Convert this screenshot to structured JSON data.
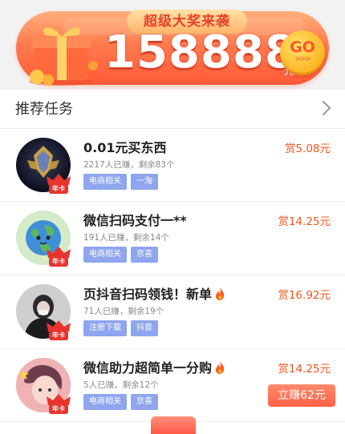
{
  "banner": {
    "title": "超级大奖来袭",
    "amount": "158888",
    "unit": "元",
    "go_label": "GO",
    "go_arrows": ">>>"
  },
  "section": {
    "title": "推荐任务"
  },
  "tasks": [
    {
      "title": "0.01元买东西",
      "stats": "2217人已赚，剩余83个",
      "tags": [
        "电商相关",
        "一淘"
      ],
      "reward": "赏5.08元",
      "badge": "年卡"
    },
    {
      "title": "微信扫码支付一**",
      "stats": "191人已赚，剩余14个",
      "tags": [
        "电商相关",
        "京喜"
      ],
      "reward": "赏14.25元",
      "badge": "年卡"
    },
    {
      "title": "页抖音扫码领钱！新单",
      "stats": "71人已赚，剩余19个",
      "tags": [
        "注册下载",
        "抖音"
      ],
      "reward": "赏16.92元",
      "badge": "年卡"
    },
    {
      "title": "微信助力超简单一分购",
      "stats": "5人已赚，剩余12个",
      "tags": [
        "电商相关",
        "京喜"
      ],
      "reward": "赏14.25元",
      "button": "立赚62元",
      "badge": "年卡"
    }
  ],
  "icons": {
    "chevron": "chevron-right-icon",
    "fire": "fire-icon",
    "crown": "crown-icon",
    "gift": "gift-icon"
  },
  "colors": {
    "accent": "#ff5a37",
    "reward": "#f0541e",
    "tag": "#8fa6ee"
  }
}
